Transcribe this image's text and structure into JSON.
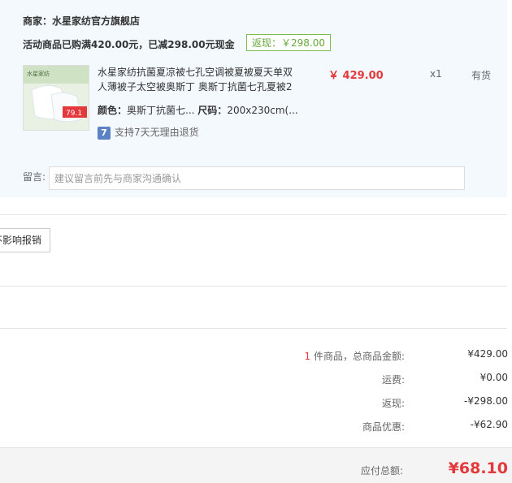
{
  "shop": {
    "merchant": "商家：水星家纺官方旗舰店",
    "promo": "活动商品已购满420.00元，已减298.00元现金",
    "cashback_badge": "返现：￥298.00"
  },
  "item": {
    "thumb_label": "水星家纺",
    "thumb_price": "79.1",
    "title": "水星家纺抗菌夏凉被七孔空调被夏被夏天单双人薄被子太空被奥斯丁 奥斯丁抗菌七孔夏被2",
    "price": "￥ 429.00",
    "quantity": "x1",
    "stock": "有货",
    "color_key": "颜色：",
    "color_val": "奥斯丁抗菌七...",
    "size_key": "尺码：",
    "size_val": "200x230cm(...",
    "return_icon": "7",
    "return_text": "支持7天无理由退货"
  },
  "message": {
    "label": "留言:",
    "placeholder": "建议留言前先与商家沟通确认"
  },
  "invoice": {
    "button": "不影响报销"
  },
  "summary": {
    "count": "1",
    "goods_label": " 件商品，总商品金额:",
    "goods_value": "¥429.00",
    "shipping_label": "运费:",
    "shipping_value": "¥0.00",
    "cashback_label": "返现:",
    "cashback_value": "-¥298.00",
    "discount_label": "商品优惠:",
    "discount_value": "-¥62.90",
    "total_label": "应付总额:",
    "total_value": "¥68.10"
  },
  "colors": {
    "accent_red": "#e4393c",
    "panel_bg": "#f3f9fd",
    "badge_green": "#66a83a"
  }
}
